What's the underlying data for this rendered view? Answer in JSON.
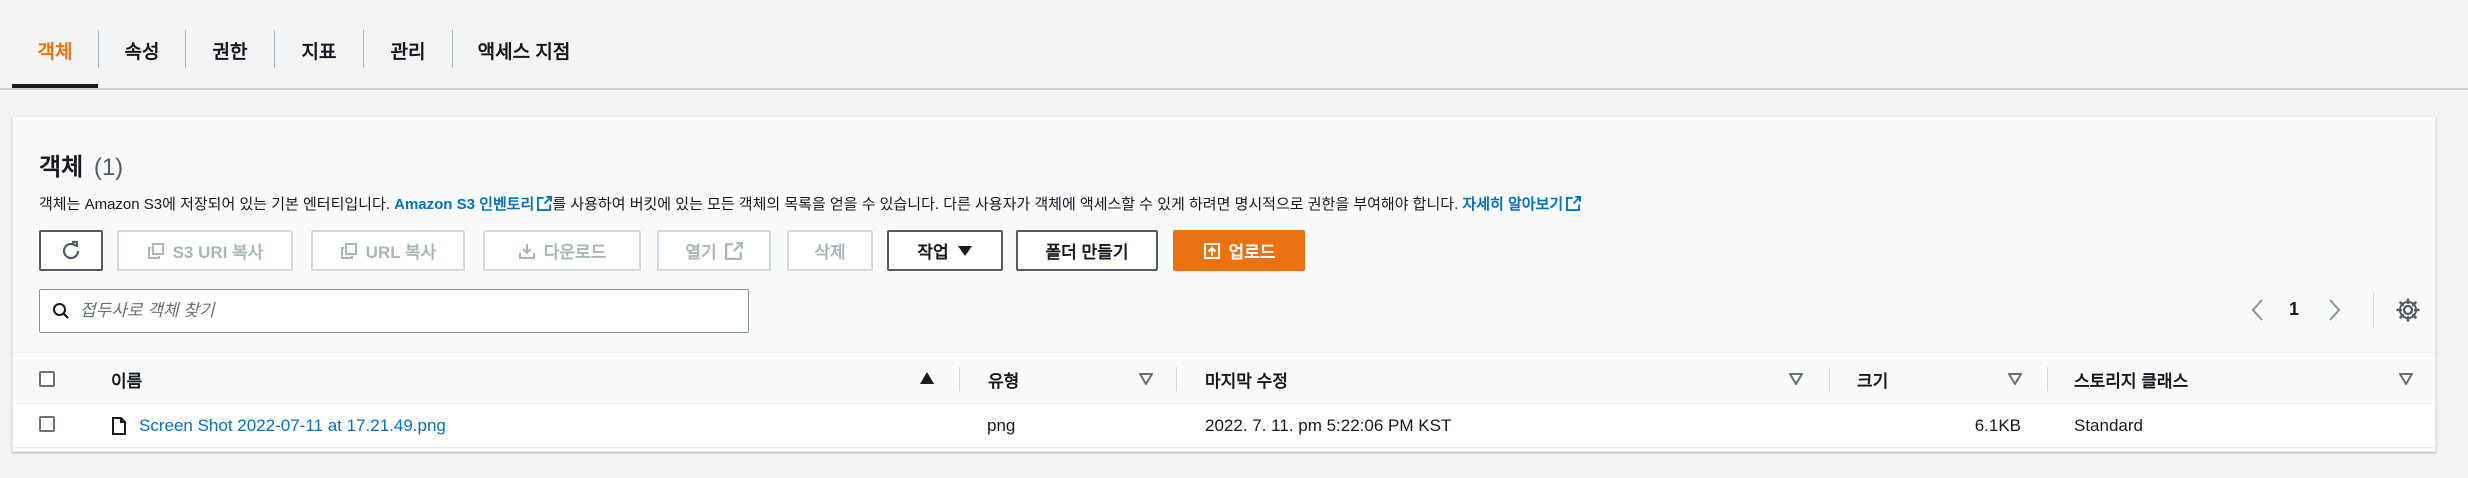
{
  "tabs": [
    {
      "label": "객체",
      "active": true
    },
    {
      "label": "속성",
      "active": false
    },
    {
      "label": "권한",
      "active": false
    },
    {
      "label": "지표",
      "active": false
    },
    {
      "label": "관리",
      "active": false
    },
    {
      "label": "액세스 지점",
      "active": false
    }
  ],
  "panel": {
    "title": "객체",
    "count": "(1)",
    "description": {
      "part1": "객체는 Amazon S3에 저장되어 있는 기본 엔터티입니다. ",
      "link1": "Amazon S3 인벤토리",
      "part2": "를 사용하여 버킷에 있는 모든 객체의 목록을 얻을 수 있습니다. 다른 사용자가 객체에 액세스할 수 있게 하려면 명시적으로 권한을 부여해야 합니다. ",
      "link2": "자세히 알아보기"
    }
  },
  "toolbar": {
    "refresh_icon": "refresh-icon",
    "copy_s3_uri": "S3 URI 복사",
    "copy_url": "URL 복사",
    "download": "다운로드",
    "open": "열기",
    "delete": "삭제",
    "actions": "작업",
    "create_folder": "폴더 만들기",
    "upload": "업로드"
  },
  "search": {
    "placeholder": "접두사로 객체 찾기",
    "value": ""
  },
  "pagination": {
    "current_page": "1"
  },
  "table": {
    "headers": {
      "name": "이름",
      "type": "유형",
      "last_modified": "마지막 수정",
      "size": "크기",
      "storage_class": "스토리지 클래스"
    },
    "rows": [
      {
        "name": "Screen Shot 2022-07-11 at 17.21.49.png",
        "type": "png",
        "last_modified": "2022. 7. 11. pm 5:22:06 PM KST",
        "size": "6.1KB",
        "storage_class": "Standard"
      }
    ]
  },
  "colors": {
    "accent": "#ec7211",
    "link": "#0073bb",
    "text": "#16191f",
    "disabled": "#aab7b8"
  }
}
